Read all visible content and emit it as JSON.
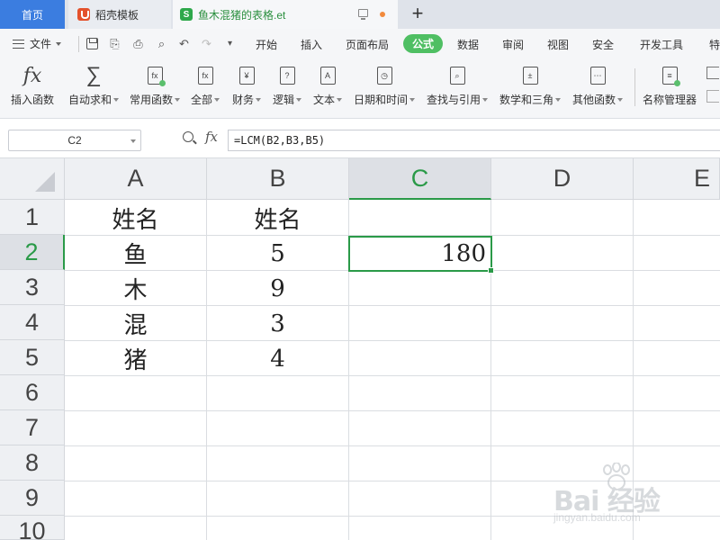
{
  "tabs": {
    "home": "首页",
    "daoke": "稻壳模板",
    "file": "鱼木混猪的表格.et",
    "add": "+"
  },
  "menu": {
    "file": "文件",
    "items": [
      "开始",
      "插入",
      "页面布局",
      "公式",
      "数据",
      "审阅",
      "视图",
      "安全",
      "开发工具",
      "特"
    ],
    "active": "公式"
  },
  "ribbon": {
    "items": [
      "插入函数",
      "自动求和",
      "常用函数",
      "全部",
      "财务",
      "逻辑",
      "文本",
      "日期和时间",
      "查找与引用",
      "数学和三角",
      "其他函数",
      "名称管理器"
    ]
  },
  "formula_bar": {
    "name_box": "C2",
    "fx": "fx",
    "formula": "=LCM(B2,B3,B5)"
  },
  "sheet": {
    "columns": [
      "A",
      "B",
      "C",
      "D",
      "E"
    ],
    "rows": [
      "1",
      "2",
      "3",
      "4",
      "5",
      "6",
      "7",
      "8",
      "9",
      "10"
    ],
    "active_cell": "C2",
    "cells": {
      "A1": "姓名",
      "B1": "姓名",
      "A2": "鱼",
      "B2": "5",
      "C2": "180",
      "A3": "木",
      "B3": "9",
      "A4": "混",
      "B4": "3",
      "A5": "猪",
      "B5": "4"
    }
  },
  "watermark": {
    "brand": "Bai 经验",
    "url": "jingyan.baidu.com"
  },
  "colors": {
    "accent_green": "#2a9a48",
    "tab_blue": "#3b7de0",
    "active_menu": "#4fbf63"
  }
}
